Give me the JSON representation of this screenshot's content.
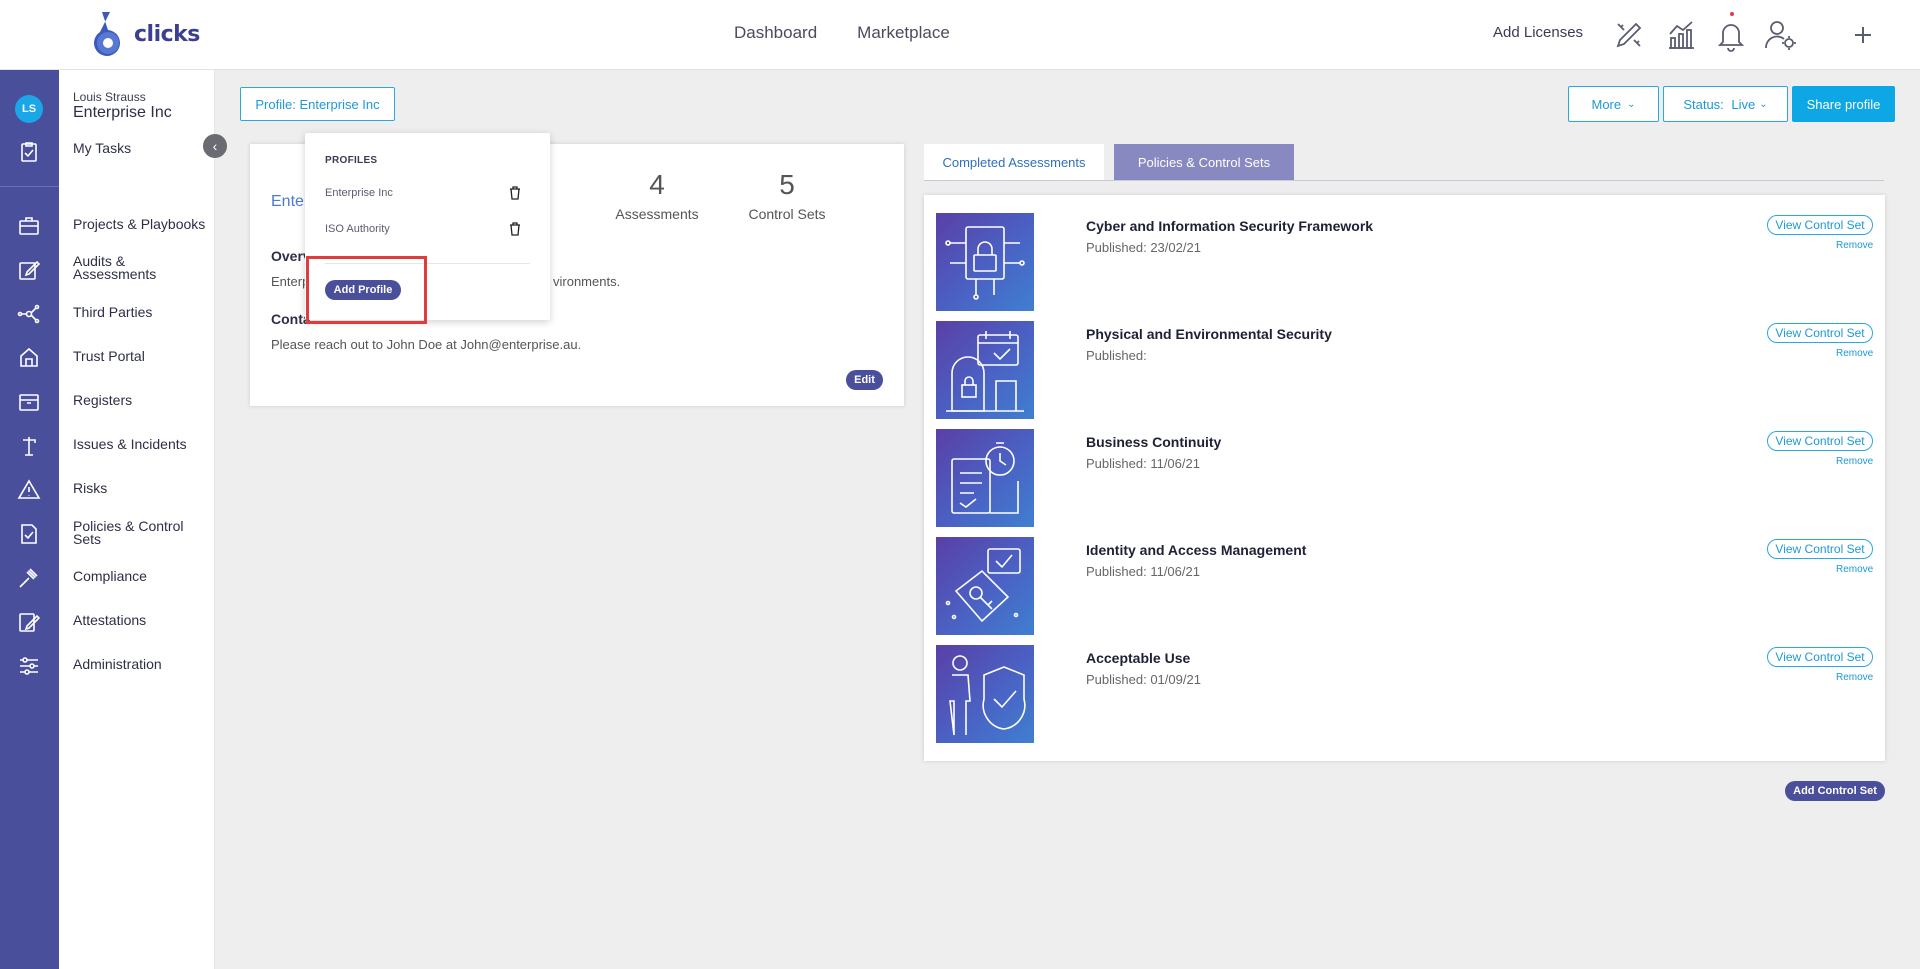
{
  "topbar": {
    "logo_text": "clicks",
    "nav": [
      "Dashboard",
      "Marketplace"
    ],
    "add_licenses": "Add Licenses",
    "icons": [
      "design-tools-icon",
      "analytics-icon",
      "bell-icon",
      "user-settings-icon",
      "plus-icon"
    ]
  },
  "user": {
    "initials": "LS",
    "name": "Louis Strauss",
    "org": "Enterprise Inc"
  },
  "sidebar": {
    "my_tasks": "My Tasks",
    "items": [
      "Projects & Playbooks",
      "Audits & Assessments",
      "Third Parties",
      "Trust Portal",
      "Registers",
      "Issues & Incidents",
      "Risks",
      "Policies & Control Sets",
      "Compliance",
      "Attestations",
      "Administration"
    ]
  },
  "profile_button": {
    "prefix": "Profile: ",
    "value": "Enterprise Inc"
  },
  "actions": {
    "more": "More",
    "status_prefix": "Status: ",
    "status_value": "Live",
    "share": "Share profile"
  },
  "dropdown": {
    "heading": "PROFILES",
    "profiles": [
      "Enterprise Inc",
      "ISO Authority"
    ],
    "add_label": "Add Profile"
  },
  "card": {
    "title": "Enter",
    "stats": [
      {
        "value": "4",
        "label": "Assessments"
      },
      {
        "value": "5",
        "label": "Control Sets"
      }
    ],
    "overview_heading": "Overv",
    "overview_text_start": "Enterp",
    "overview_text_end": "vironments.",
    "contact_heading": "Conta",
    "contact_text": "Please reach out to John Doe at John@enterprise.au.",
    "edit_label": "Edit"
  },
  "tabs": [
    "Completed Assessments",
    "Policies & Control Sets"
  ],
  "active_tab": "Policies & Control Sets",
  "control_sets": [
    {
      "title": "Cyber and Information Security Framework",
      "published": "Published: 23/02/21",
      "icon": "cyber-security-icon"
    },
    {
      "title": "Physical and Environmental Security",
      "published": "Published:",
      "icon": "physical-security-icon"
    },
    {
      "title": "Business Continuity",
      "published": "Published: 11/06/21",
      "icon": "business-continuity-icon"
    },
    {
      "title": "Identity and Access Management",
      "published": "Published: 11/06/21",
      "icon": "identity-access-icon"
    },
    {
      "title": "Acceptable Use",
      "published": "Published: 01/09/21",
      "icon": "acceptable-use-icon"
    }
  ],
  "control_set_actions": {
    "view": "View Control Set",
    "remove": "Remove"
  },
  "add_control_set": "Add Control Set",
  "colors": {
    "rail": "#4a4f9c",
    "accent_blue": "#0ea7e6",
    "active_tab": "#8789c0",
    "highlight": "#e03c3c"
  }
}
